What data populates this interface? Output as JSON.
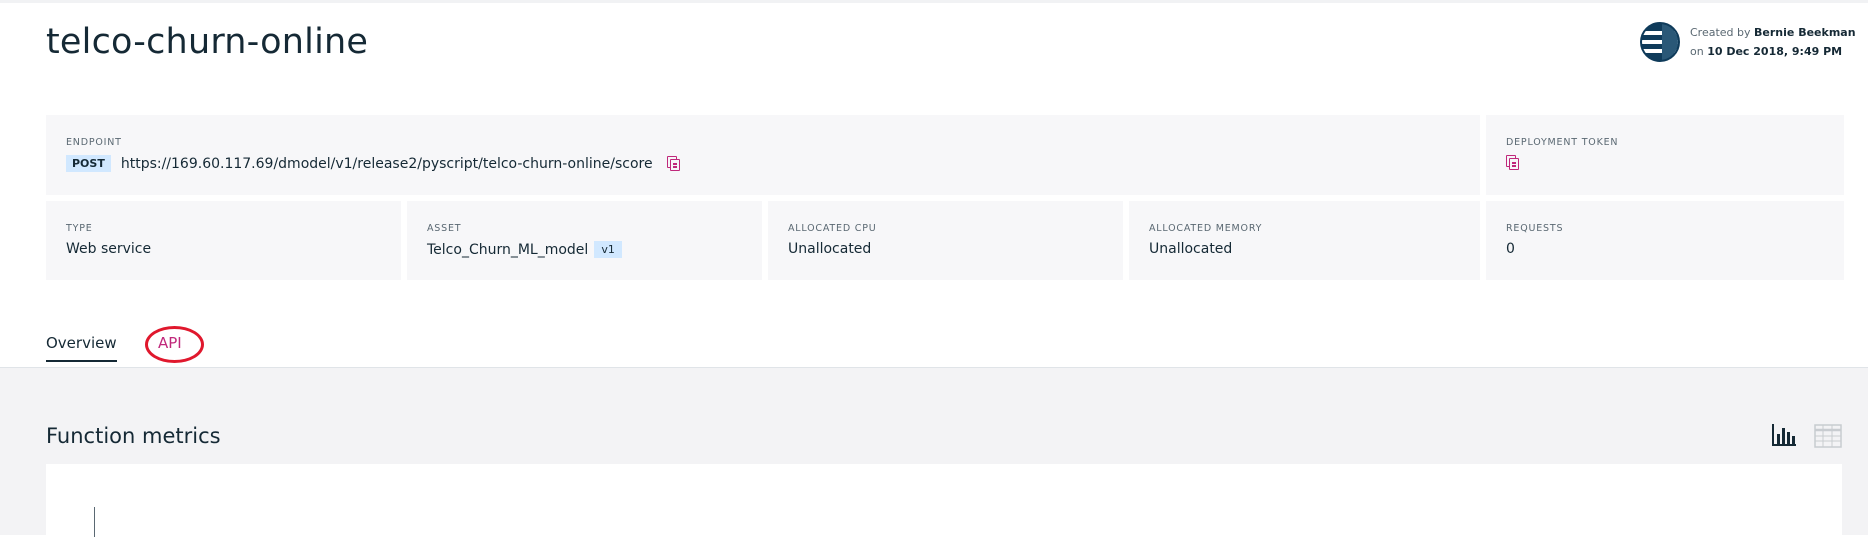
{
  "header": {
    "title": "telco-churn-online",
    "created_by_label": "Created by",
    "created_by_name": "Bernie Beekman",
    "created_on_label": "on",
    "created_on_date": "10 Dec 2018, 9:49 PM"
  },
  "endpoint": {
    "label": "ENDPOINT",
    "method": "POST",
    "url": "https://169.60.117.69/dmodel/v1/release2/pyscript/telco-churn-online/score"
  },
  "deployment_token": {
    "label": "DEPLOYMENT TOKEN"
  },
  "stats": {
    "type": {
      "label": "TYPE",
      "value": "Web service"
    },
    "asset": {
      "label": "ASSET",
      "value": "Telco_Churn_ML_model",
      "version": "v1"
    },
    "cpu": {
      "label": "ALLOCATED CPU",
      "value": "Unallocated"
    },
    "memory": {
      "label": "ALLOCATED MEMORY",
      "value": "Unallocated"
    },
    "requests": {
      "label": "REQUESTS",
      "value": "0"
    }
  },
  "tabs": [
    {
      "label": "Overview",
      "active": true
    },
    {
      "label": "API",
      "active": false
    }
  ],
  "metrics": {
    "title": "Function metrics"
  },
  "colors": {
    "accent": "#c0287b",
    "text": "#152935",
    "annotation": "#e0182d",
    "badge": "#d1e8ff"
  },
  "icons": [
    "copy-icon",
    "bar-chart-icon",
    "table-icon",
    "avatar"
  ]
}
